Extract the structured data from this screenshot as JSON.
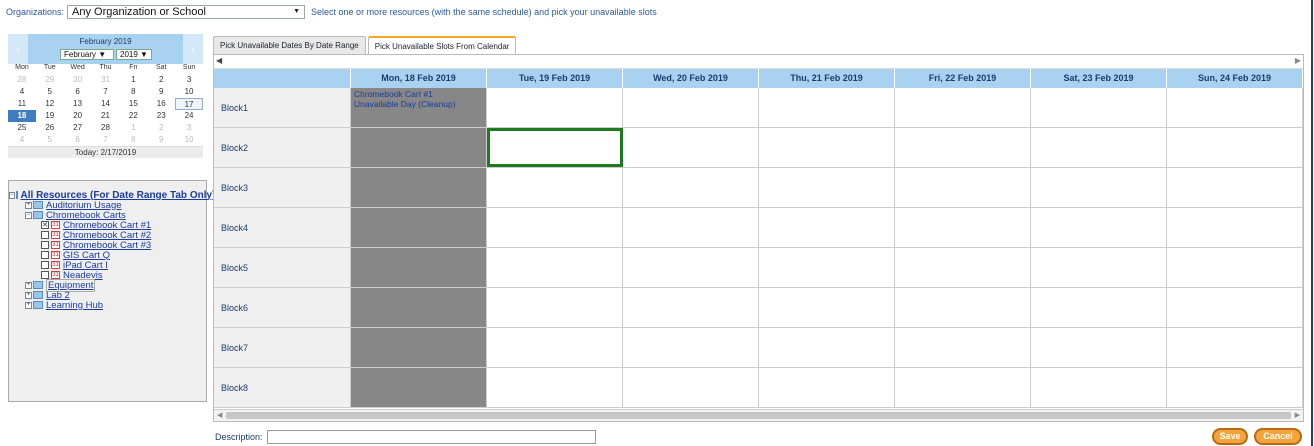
{
  "top": {
    "org_label": "Organizations:",
    "org_value": "Any Organization or School",
    "hint": "Select one or more resources (with the same schedule) and pick your unavailable slots"
  },
  "calendar": {
    "title": "February 2019",
    "month": "February",
    "year": "2019",
    "prev": "‹",
    "next": "›",
    "dow": [
      "Mon",
      "Tue",
      "Wed",
      "Thu",
      "Fri",
      "Sat",
      "Sun"
    ],
    "days": [
      {
        "d": "28",
        "t": "other"
      },
      {
        "d": "29",
        "t": "other"
      },
      {
        "d": "30",
        "t": "other"
      },
      {
        "d": "31",
        "t": "other"
      },
      {
        "d": "1",
        "t": ""
      },
      {
        "d": "2",
        "t": ""
      },
      {
        "d": "3",
        "t": ""
      },
      {
        "d": "4",
        "t": ""
      },
      {
        "d": "5",
        "t": ""
      },
      {
        "d": "6",
        "t": ""
      },
      {
        "d": "7",
        "t": ""
      },
      {
        "d": "8",
        "t": ""
      },
      {
        "d": "9",
        "t": ""
      },
      {
        "d": "10",
        "t": ""
      },
      {
        "d": "11",
        "t": ""
      },
      {
        "d": "12",
        "t": ""
      },
      {
        "d": "13",
        "t": ""
      },
      {
        "d": "14",
        "t": ""
      },
      {
        "d": "15",
        "t": ""
      },
      {
        "d": "16",
        "t": ""
      },
      {
        "d": "17",
        "t": "today"
      },
      {
        "d": "18",
        "t": "selected"
      },
      {
        "d": "19",
        "t": ""
      },
      {
        "d": "20",
        "t": ""
      },
      {
        "d": "21",
        "t": ""
      },
      {
        "d": "22",
        "t": ""
      },
      {
        "d": "23",
        "t": ""
      },
      {
        "d": "24",
        "t": ""
      },
      {
        "d": "25",
        "t": ""
      },
      {
        "d": "26",
        "t": ""
      },
      {
        "d": "27",
        "t": ""
      },
      {
        "d": "28",
        "t": ""
      },
      {
        "d": "1",
        "t": "other"
      },
      {
        "d": "2",
        "t": "other"
      },
      {
        "d": "3",
        "t": "other"
      },
      {
        "d": "4",
        "t": "other"
      },
      {
        "d": "5",
        "t": "other"
      },
      {
        "d": "6",
        "t": "other"
      },
      {
        "d": "7",
        "t": "other"
      },
      {
        "d": "8",
        "t": "other"
      },
      {
        "d": "9",
        "t": "other"
      },
      {
        "d": "10",
        "t": "other"
      }
    ],
    "today_label": "Today: 2/17/2019"
  },
  "tree": [
    {
      "label": "All Resources (For Date Range Tab Only)",
      "level": 0,
      "toggle": "−",
      "kind": "folder",
      "style": "bold"
    },
    {
      "label": "Auditorium Usage",
      "level": 1,
      "toggle": "+",
      "kind": "folder"
    },
    {
      "label": "Chromebook Carts",
      "level": 1,
      "toggle": "−",
      "kind": "folder"
    },
    {
      "label": "Chromebook Cart #1",
      "level": 2,
      "kind": "item",
      "checked": "✕"
    },
    {
      "label": "Chromebook Cart #2",
      "level": 2,
      "kind": "item"
    },
    {
      "label": "Chromebook Cart #3",
      "level": 2,
      "kind": "item"
    },
    {
      "label": "GIS Cart Q",
      "level": 2,
      "kind": "item"
    },
    {
      "label": "iPad Cart I",
      "level": 2,
      "kind": "item"
    },
    {
      "label": "Neadevis",
      "level": 2,
      "kind": "item"
    },
    {
      "label": "Equipment",
      "level": 1,
      "toggle": "+",
      "kind": "folder",
      "style": "boxed"
    },
    {
      "label": "Lab 2",
      "level": 1,
      "toggle": "+",
      "kind": "folder"
    },
    {
      "label": "Learning Hub",
      "level": 1,
      "toggle": "+",
      "kind": "folder"
    }
  ],
  "tabs": [
    "Pick Unavailable Dates By Date Range",
    "Pick Unavailable Slots From Calendar"
  ],
  "grid": {
    "scroll_left": "◀",
    "scroll_right": "▶",
    "headers": [
      "Mon, 18 Feb 2019",
      "Tue, 19 Feb 2019",
      "Wed, 20 Feb 2019",
      "Thu, 21 Feb 2019",
      "Fri, 22 Feb 2019",
      "Sat, 23 Feb 2019",
      "Sun, 24 Feb 2019"
    ],
    "blocks": [
      "Block1",
      "Block2",
      "Block3",
      "Block4",
      "Block5",
      "Block6",
      "Block7",
      "Block8"
    ],
    "unavailable_text": "Chromebook Cart #1\nUnavailable Day (Cleanup)",
    "selected_slot": "Block2 / Tue, 19 Feb 2019"
  },
  "footer": {
    "description_label": "Description:",
    "save": "Save",
    "cancel": "Cancel"
  }
}
